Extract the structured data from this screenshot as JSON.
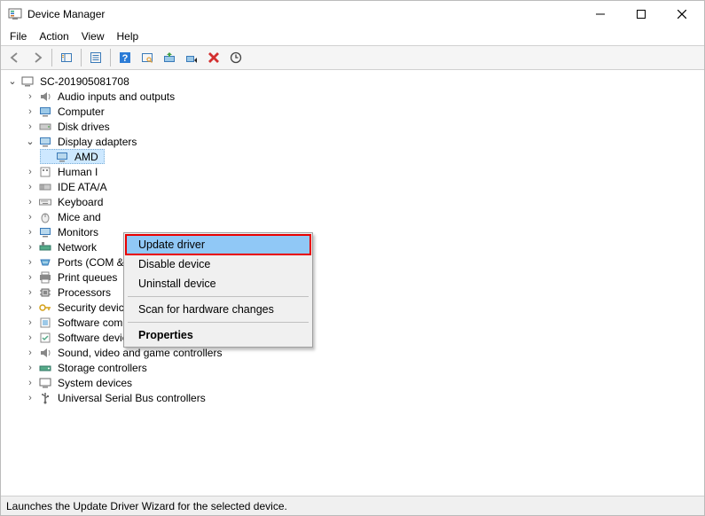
{
  "window": {
    "title": "Device Manager"
  },
  "menu": {
    "file": "File",
    "action": "Action",
    "view": "View",
    "help": "Help"
  },
  "tree": {
    "root": "SC-201905081708",
    "categories": [
      {
        "label": "Audio inputs and outputs"
      },
      {
        "label": "Computer"
      },
      {
        "label": "Disk drives"
      },
      {
        "label": "Display adapters",
        "expanded": true,
        "children": [
          {
            "label": "AMD"
          }
        ]
      },
      {
        "label": "Human Interface Devices",
        "truncated": "Human I"
      },
      {
        "label": "IDE ATA/ATAPI controllers",
        "truncated": "IDE ATA/A"
      },
      {
        "label": "Keyboards",
        "truncated": "Keyboard"
      },
      {
        "label": "Mice and other pointing devices",
        "truncated": "Mice and"
      },
      {
        "label": "Monitors",
        "truncated": "Monitors"
      },
      {
        "label": "Network adapters",
        "truncated": "Network"
      },
      {
        "label": "Ports (COM & LPT)"
      },
      {
        "label": "Print queues"
      },
      {
        "label": "Processors"
      },
      {
        "label": "Security devices"
      },
      {
        "label": "Software components"
      },
      {
        "label": "Software devices"
      },
      {
        "label": "Sound, video and game controllers"
      },
      {
        "label": "Storage controllers"
      },
      {
        "label": "System devices"
      },
      {
        "label": "Universal Serial Bus controllers"
      }
    ]
  },
  "context_menu": {
    "update": "Update driver",
    "disable": "Disable device",
    "uninstall": "Uninstall device",
    "scan": "Scan for hardware changes",
    "properties": "Properties"
  },
  "statusbar": {
    "text": "Launches the Update Driver Wizard for the selected device."
  }
}
